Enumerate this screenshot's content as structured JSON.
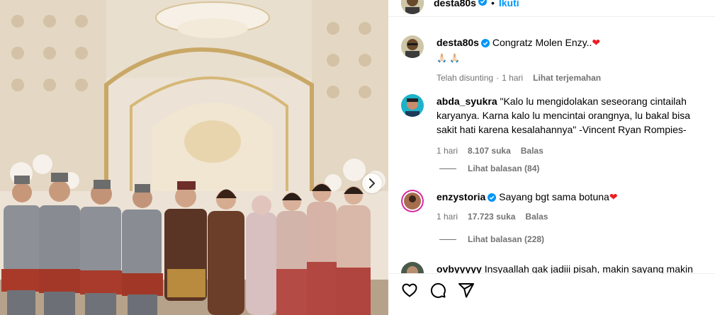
{
  "header": {
    "username": "desta80s",
    "separator": "•",
    "follow_label": "Ikuti"
  },
  "caption": {
    "username": "desta80s",
    "text": "Congratz Molen Enzy..",
    "heart": "❤",
    "second_line": "🙏🏻 🙏🏻",
    "edited": "Telah disunting",
    "time": "1 hari",
    "translate": "Lihat terjemahan"
  },
  "comments": [
    {
      "username": "abda_syukra",
      "text": "\"Kalo lu mengidolakan seseorang cintailah karyanya. Karna kalo lu mencintai orangnya, lu bakal bisa sakit hati karena kesalahannya\" -Vincent Ryan Rompies-",
      "time": "1 hari",
      "likes": "8.107 suka",
      "reply": "Balas",
      "view_replies": "Lihat balasan (84)"
    },
    {
      "username": "enzystoria",
      "text": "Sayang bgt sama botuna",
      "heart": "❤",
      "time": "1 hari",
      "likes": "17.723 suka",
      "reply": "Balas",
      "view_replies": "Lihat balasan (228)"
    },
    {
      "username": "ovbyyyyy",
      "text": "Insyaallah gak jadiii pisah, makin sayang makin"
    }
  ],
  "colors": {
    "link": "#0095f6",
    "verified": "#0095f6",
    "secondary": "#737373",
    "heart": "#ed1c24"
  },
  "icons": [
    "verified-badge-icon",
    "chevron-right-icon",
    "heart-icon",
    "comment-icon",
    "share-icon"
  ]
}
